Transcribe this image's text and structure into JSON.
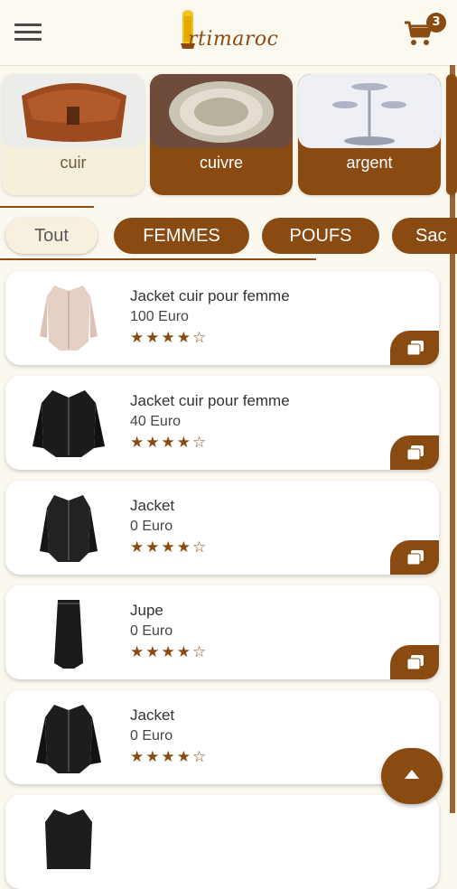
{
  "header": {
    "logo_text": "rtimaroc",
    "cart_count": "3"
  },
  "categories": [
    {
      "label": "cuir",
      "style": "light"
    },
    {
      "label": "cuivre",
      "style": "dark"
    },
    {
      "label": "argent",
      "style": "dark"
    }
  ],
  "filters": {
    "tout": "Tout",
    "femmes": "FEMMES",
    "poufs": "POUFS",
    "sac": "Sac"
  },
  "products": [
    {
      "name": "Jacket cuir pour femme",
      "price": "100 Euro",
      "stars": "★★★★☆"
    },
    {
      "name": "Jacket cuir pour femme",
      "price": "40 Euro",
      "stars": "★★★★☆"
    },
    {
      "name": "Jacket",
      "price": "0 Euro",
      "stars": "★★★★☆"
    },
    {
      "name": "Jupe",
      "price": "0 Euro",
      "stars": "★★★★☆"
    },
    {
      "name": "Jacket",
      "price": "0 Euro",
      "stars": "★★★★☆"
    }
  ],
  "colors": {
    "brand": "#8a4b12",
    "background": "#fbf8ef",
    "light_card": "#f6efd9"
  },
  "icons": {
    "menu": "hamburger-menu-icon",
    "cart": "shopping-cart-icon",
    "add": "add-to-cart-icon",
    "scroll_top": "chevron-up-icon"
  }
}
